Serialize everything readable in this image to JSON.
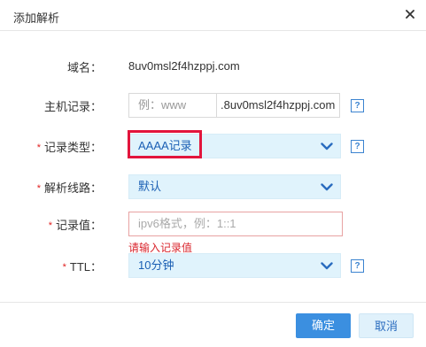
{
  "dialog": {
    "title": "添加解析",
    "close_icon": "close-icon"
  },
  "form": {
    "domain": {
      "label": "域名：",
      "value": "8uv0msl2f4hzppj.com"
    },
    "host": {
      "label": "主机记录：",
      "placeholder": "例：www",
      "suffix": ".8uv0msl2f4hzppj.com",
      "required": false
    },
    "record_type": {
      "label": "记录类型：",
      "value": "AAAA记录",
      "required": true
    },
    "line": {
      "label": "解析线路：",
      "value": "默认",
      "required": true
    },
    "record_value": {
      "label": "记录值：",
      "placeholder": "ipv6格式，例：1::1",
      "error": "请输入记录值",
      "required": true
    },
    "ttl": {
      "label": "TTL：",
      "value": "10分钟",
      "required": true
    },
    "required_mark": "*",
    "help_label": "?"
  },
  "footer": {
    "ok_label": "确定",
    "cancel_label": "取消"
  },
  "colors": {
    "accent": "#3b8fe0",
    "highlight": "#e2153c",
    "error": "#d9252d",
    "select_bg": "#e0f3fc"
  }
}
